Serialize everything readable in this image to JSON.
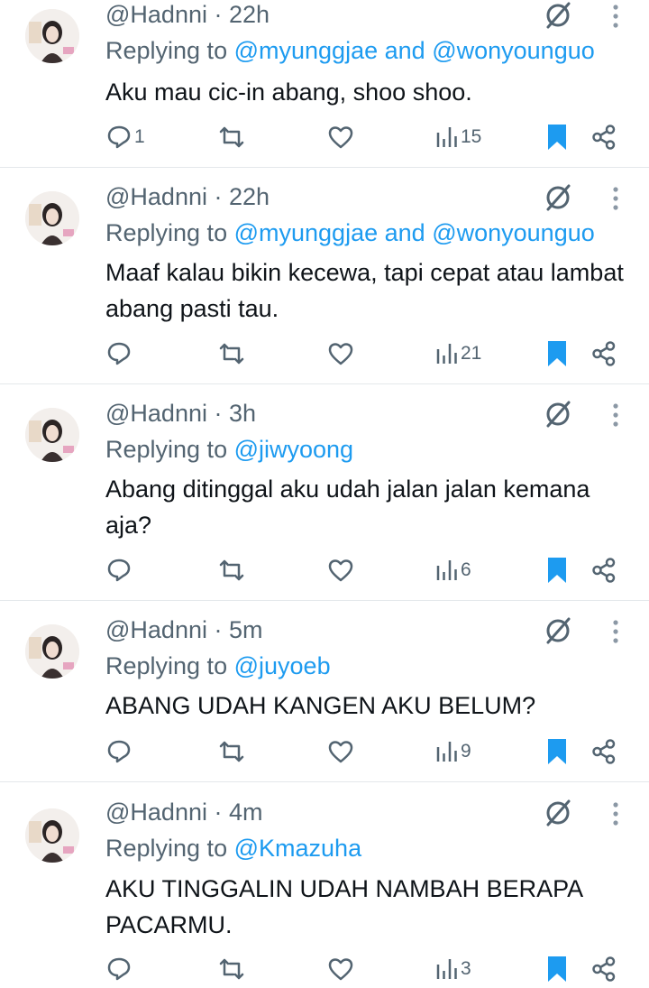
{
  "accent_color": "#1d9bf0",
  "muted_color": "#536471",
  "tweets": [
    {
      "handle": "@Hadnni",
      "time": "· 22h",
      "replying_prefix": "Replying to",
      "mention_1": "@myunggjae",
      "joiner": "and",
      "mention_2": "@wonyounguo",
      "text": "Aku mau cic-in abang, shoo shoo.",
      "replies": "1",
      "retweets": "",
      "likes": "",
      "views": "15"
    },
    {
      "handle": "@Hadnni",
      "time": "· 22h",
      "replying_prefix": "Replying to",
      "mention_1": "@myunggjae",
      "joiner": "and",
      "mention_2": "@wonyounguo",
      "text": "Maaf kalau bikin kecewa, tapi cepat atau lambat abang pasti tau.",
      "replies": "",
      "retweets": "",
      "likes": "",
      "views": "21"
    },
    {
      "handle": "@Hadnni",
      "time": "· 3h",
      "replying_prefix": "Replying to",
      "mention_1": "@jiwyoong",
      "text": "Abang ditinggal aku udah jalan jalan kemana aja?",
      "replies": "",
      "retweets": "",
      "likes": "",
      "views": "6"
    },
    {
      "handle": "@Hadnni",
      "time": "· 5m",
      "replying_prefix": "Replying to",
      "mention_1": "@juyoeb",
      "text": "ABANG UDAH KANGEN AKU BELUM?",
      "replies": "",
      "retweets": "",
      "likes": "",
      "views": "9"
    },
    {
      "handle": "@Hadnni",
      "time": "· 4m",
      "replying_prefix": "Replying to",
      "mention_1": "@Kmazuha",
      "text": "AKU TINGGALIN UDAH NAMBAH BERAPA PACARMU.",
      "replies": "",
      "retweets": "",
      "likes": "",
      "views": "3"
    }
  ],
  "icons": {
    "top_right": "grok-slash-icon",
    "more": "more-vertical-icon",
    "reply": "reply-icon",
    "retweet": "retweet-icon",
    "like": "heart-icon",
    "views": "views-bar-icon",
    "bookmark": "bookmark-icon",
    "share": "share-icon"
  }
}
